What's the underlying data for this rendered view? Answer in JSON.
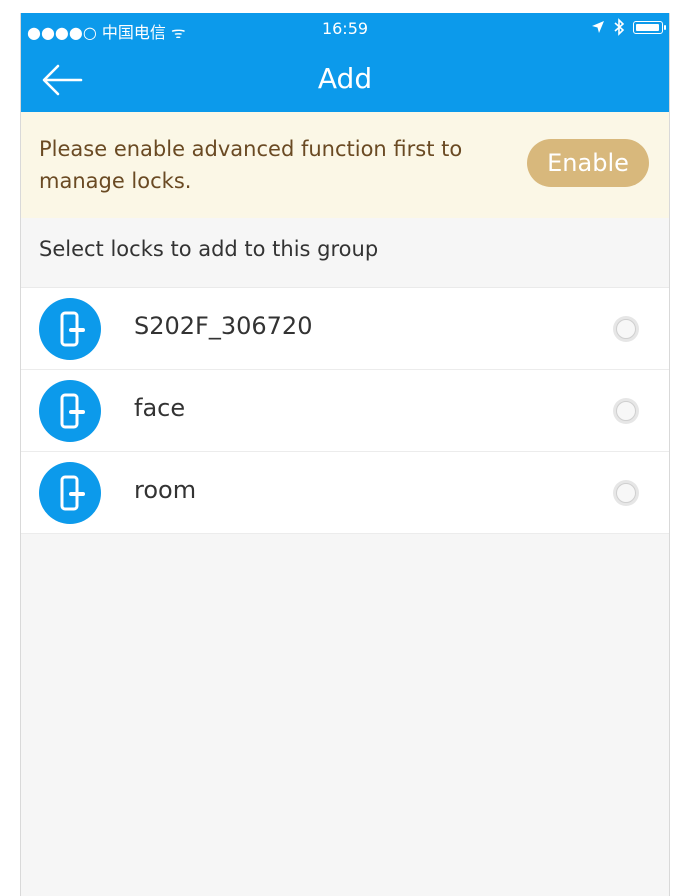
{
  "status_bar": {
    "carrier": "●●●●○ 中国电信 ᯤ",
    "time": "16:59",
    "location_icon": "location-arrow-icon",
    "bluetooth_icon": "bluetooth-icon",
    "battery_icon": "battery-icon"
  },
  "nav": {
    "title": "Add",
    "back_icon": "back-arrow-icon"
  },
  "banner": {
    "message": "Please enable advanced function first to manage locks.",
    "button_label": "Enable"
  },
  "section": {
    "header": "Select locks to add to this group"
  },
  "locks": [
    {
      "name": "S202F_306720",
      "icon": "door-lock-icon",
      "selected": false
    },
    {
      "name": "face",
      "icon": "door-lock-icon",
      "selected": false
    },
    {
      "name": "room",
      "icon": "door-lock-icon",
      "selected": false
    }
  ],
  "colors": {
    "primary": "#0c9aeb",
    "banner_bg": "#fbf7e6",
    "banner_text": "#6a4a23",
    "enable_button": "#d8b87c"
  }
}
